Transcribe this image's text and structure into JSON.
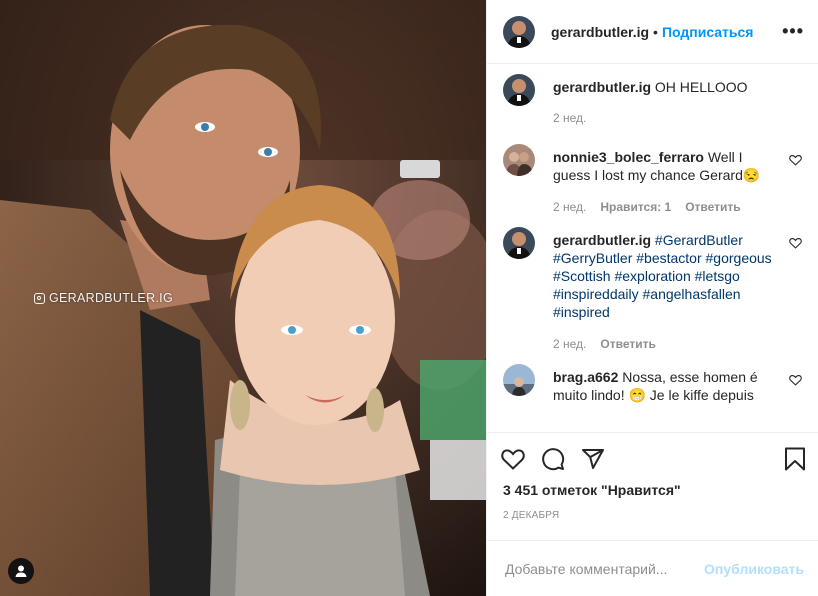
{
  "photo": {
    "watermark": "GERARDBUTLER.IG",
    "watermark_icon": "instagram-icon",
    "tag_icon": "user-tag-icon"
  },
  "header": {
    "username": "gerardbutler.ig",
    "separator": "•",
    "follow_label": "Подписаться",
    "more_label": "•••"
  },
  "comments": [
    {
      "user": "gerardbutler.ig",
      "text": "OH HELLOOO",
      "time": "2 нед.",
      "likes": "",
      "reply": ""
    },
    {
      "user": "nonnie3_bolec_ferraro",
      "text": "Well I guess I lost my chance Gerard😒",
      "time": "2 нед.",
      "likes": "Нравится: 1",
      "reply": "Ответить"
    },
    {
      "user": "gerardbutler.ig",
      "text": "#GerardButler #GerryButler #bestactor #gorgeous  #Scottish #exploration #letsgo #inspireddaily #angelhasfallen #inspired",
      "time": "2 нед.",
      "likes": "",
      "reply": "Ответить"
    },
    {
      "user": "brag.a662",
      "text": "Nossa, esse homen é muito lindo! 😁 Je le kiffe depuis",
      "time": "",
      "likes": "",
      "reply": ""
    }
  ],
  "actions": {
    "like_icon": "heart-icon",
    "comment_icon": "comment-icon",
    "share_icon": "paper-plane-icon",
    "save_icon": "bookmark-icon"
  },
  "likes_text": "3 451 отметок \"Нравится\"",
  "date_text": "2 ДЕКАБРЯ",
  "add_comment": {
    "placeholder": "Добавьте комментарий...",
    "publish_label": "Опубликовать"
  }
}
